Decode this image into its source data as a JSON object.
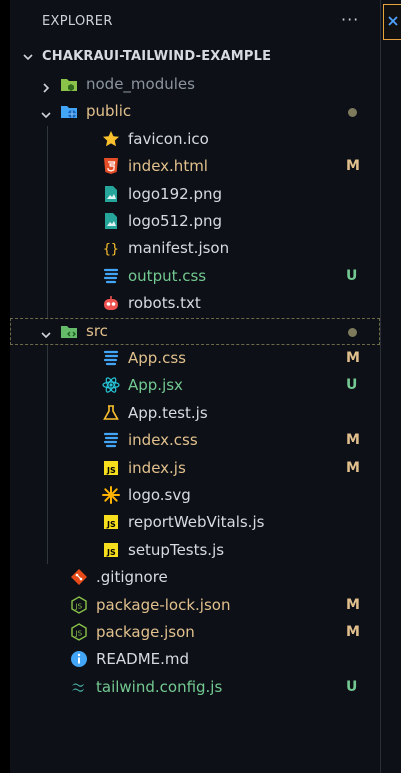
{
  "explorer": {
    "title": "EXPLORER",
    "more": "···",
    "project": "CHAKRAUI-TAILWIND-EXAMPLE"
  },
  "colors": {
    "default": "#d7dbe0",
    "modified": "#e2c08d",
    "untracked": "#73c991",
    "ignored": "#8b949e",
    "folder_label": "#e2c08d"
  },
  "tree": [
    {
      "label": "node_modules",
      "type": "folder",
      "state": "collapsed",
      "icon": "node-folder-icon",
      "status": "ignored"
    },
    {
      "label": "public",
      "type": "folder",
      "state": "expanded",
      "icon": "public-folder-icon",
      "status": "dot"
    },
    {
      "label": "favicon.ico",
      "type": "file",
      "icon": "star-icon",
      "status": ""
    },
    {
      "label": "index.html",
      "type": "file",
      "icon": "html5-icon",
      "status": "M"
    },
    {
      "label": "logo192.png",
      "type": "file",
      "icon": "image-icon",
      "status": ""
    },
    {
      "label": "logo512.png",
      "type": "file",
      "icon": "image-icon",
      "status": ""
    },
    {
      "label": "manifest.json",
      "type": "file",
      "icon": "json-braces-icon",
      "status": ""
    },
    {
      "label": "output.css",
      "type": "file",
      "icon": "css3-icon",
      "status": "U"
    },
    {
      "label": "robots.txt",
      "type": "file",
      "icon": "robot-icon",
      "status": ""
    },
    {
      "label": "src",
      "type": "folder",
      "state": "expanded",
      "icon": "src-folder-icon",
      "status": "dot"
    },
    {
      "label": "App.css",
      "type": "file",
      "icon": "css3-icon",
      "status": "M"
    },
    {
      "label": "App.jsx",
      "type": "file",
      "icon": "react-icon",
      "status": "U"
    },
    {
      "label": "App.test.js",
      "type": "file",
      "icon": "test-flask-icon",
      "status": ""
    },
    {
      "label": "index.css",
      "type": "file",
      "icon": "css3-icon",
      "status": "M"
    },
    {
      "label": "index.js",
      "type": "file",
      "icon": "js-icon",
      "status": "M"
    },
    {
      "label": "logo.svg",
      "type": "file",
      "icon": "svg-asterisk-icon",
      "status": ""
    },
    {
      "label": "reportWebVitals.js",
      "type": "file",
      "icon": "js-icon",
      "status": ""
    },
    {
      "label": "setupTests.js",
      "type": "file",
      "icon": "js-icon",
      "status": ""
    },
    {
      "label": ".gitignore",
      "type": "file",
      "icon": "git-icon",
      "status": ""
    },
    {
      "label": "package-lock.json",
      "type": "file",
      "icon": "nodejs-icon",
      "status": "M"
    },
    {
      "label": "package.json",
      "type": "file",
      "icon": "nodejs-icon",
      "status": "M"
    },
    {
      "label": "README.md",
      "type": "file",
      "icon": "info-icon",
      "status": ""
    },
    {
      "label": "tailwind.config.js",
      "type": "file",
      "icon": "tailwind-icon",
      "status": "U"
    }
  ]
}
